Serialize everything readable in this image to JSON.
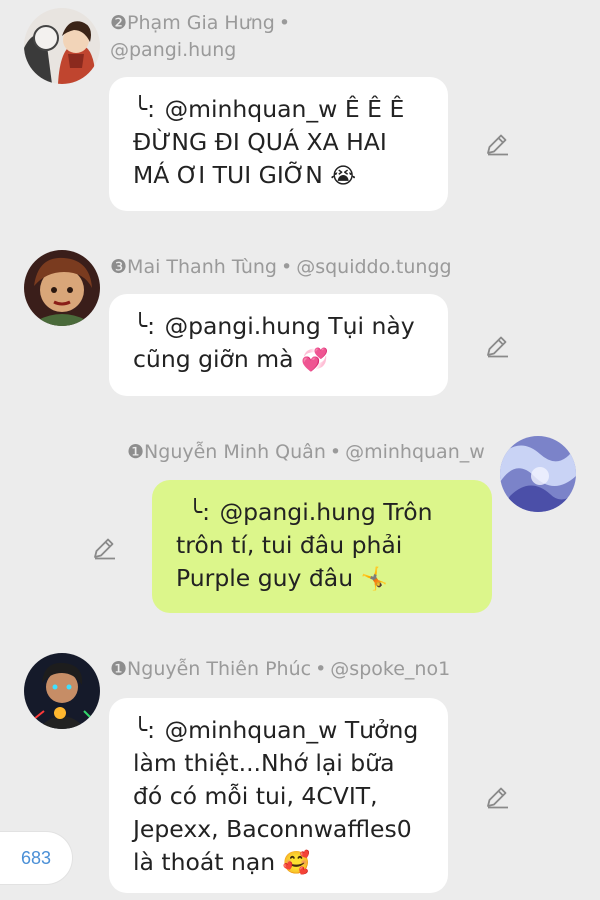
{
  "messages": [
    {
      "rank": "❷",
      "name": "Phạm Gia Hưng",
      "separator": "•",
      "handle": "@pangi.hung",
      "reply_mark": "╰:",
      "lines": [
        "@minhquan_w Ê Ê Ê",
        "ĐỪNG ĐI QUÁ XA HAI",
        "MÁ ƠI TUI GIỠN"
      ],
      "emoji": "😭",
      "avatar_icon": "anime-avatar-icon",
      "edit_icon": "pencil-icon"
    },
    {
      "rank": "❸",
      "name": "Mai Thanh Tùng",
      "separator": "•",
      "handle": "@squiddo.tungg",
      "reply_mark": "╰:",
      "lines": [
        "@pangi.hung Tụi này",
        "cũng giỡn mà"
      ],
      "emoji": "💞",
      "avatar_icon": "anime-avatar-icon",
      "edit_icon": "pencil-icon"
    },
    {
      "rank": "❶",
      "name": "Nguyễn Minh Quân",
      "separator": "•",
      "handle": "@minhquan_w",
      "reply_mark": "╰:",
      "lines": [
        "@pangi.hung Trôn",
        "trôn tí, tui đâu phải",
        "Purple guy đâu"
      ],
      "emoji": "🤸",
      "avatar_icon": "abstract-avatar-icon",
      "edit_icon": "pencil-icon"
    },
    {
      "rank": "❶",
      "name": "Nguyễn Thiên Phúc",
      "separator": "•",
      "handle": "@spoke_no1",
      "reply_mark": "╰:",
      "lines": [
        "@minhquan_w Tưởng",
        "làm thiệt...Nhớ lại bữa",
        "đó có mỗi tui, 4CVIT,",
        "Jepexx, Baconnwaffles0",
        "là thoát nạn"
      ],
      "emoji": "🥰",
      "avatar_icon": "anime-avatar-icon",
      "edit_icon": "pencil-icon"
    }
  ],
  "counter": {
    "value": "683"
  },
  "colors": {
    "background": "#ececec",
    "bubble_white": "#ffffff",
    "bubble_own": "#dcf68b",
    "meta_text": "#9a9a9a",
    "counter_text": "#4a8fd6"
  }
}
